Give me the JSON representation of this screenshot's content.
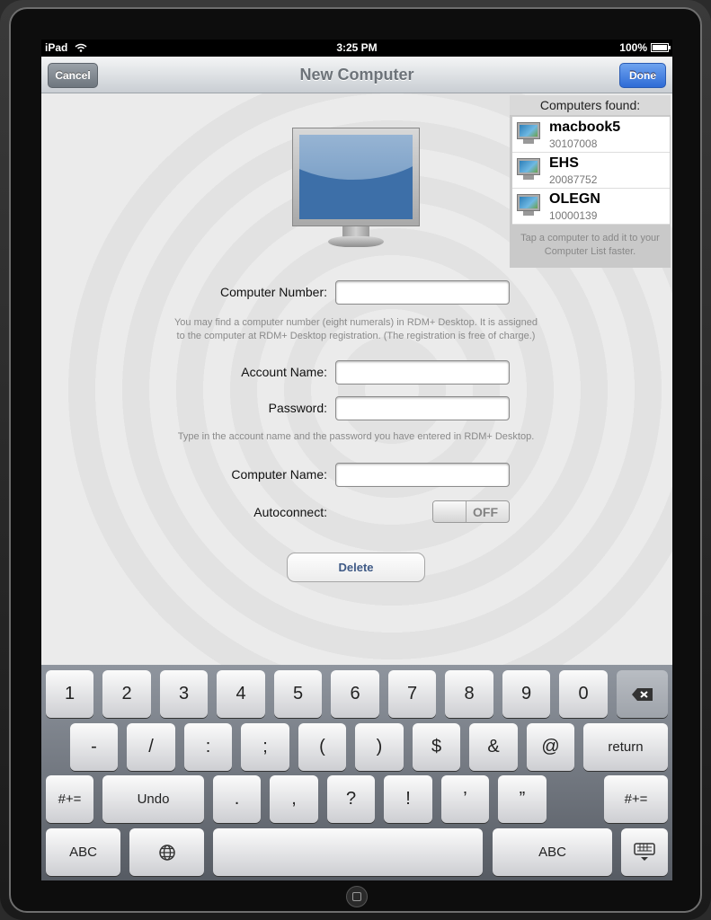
{
  "status": {
    "device": "iPad",
    "time": "3:25 PM",
    "battery": "100%",
    "battery_level": 1.0
  },
  "nav": {
    "title": "New Computer",
    "cancel": "Cancel",
    "done": "Done"
  },
  "found": {
    "header": "Computers found:",
    "items": [
      {
        "name": "macbook5",
        "number": "30107008"
      },
      {
        "name": "EHS",
        "number": "20087752"
      },
      {
        "name": "OLEGN",
        "number": "10000139"
      }
    ],
    "hint": "Tap a computer to add it to your Computer List faster."
  },
  "form": {
    "computer_number_label": "Computer Number:",
    "computer_number_value": "",
    "computer_number_hint_1": "You may find a computer number (eight numerals) in RDM+ Desktop. It is assigned",
    "computer_number_hint_2": "to the computer at RDM+ Desktop registration. (The registration is free of charge.)",
    "account_name_label": "Account Name:",
    "account_name_value": "",
    "password_label": "Password:",
    "password_value": "",
    "account_hint": "Type in the account name and the password you have entered in RDM+ Desktop.",
    "computer_name_label": "Computer Name:",
    "computer_name_value": "",
    "autoconnect_label": "Autoconnect:",
    "autoconnect_state": "OFF",
    "delete_label": "Delete"
  },
  "keyboard": {
    "row1": [
      "1",
      "2",
      "3",
      "4",
      "5",
      "6",
      "7",
      "8",
      "9",
      "0"
    ],
    "row2": [
      "-",
      "/",
      ":",
      ";",
      "(",
      ")",
      "$",
      "&",
      "@"
    ],
    "return": "return",
    "row3_left": "#+=",
    "undo": "Undo",
    "row3": [
      ".",
      ",",
      "?",
      "!",
      "’",
      "”"
    ],
    "row3_right": "#+=",
    "abc": "ABC",
    "abc_right": "ABC"
  }
}
